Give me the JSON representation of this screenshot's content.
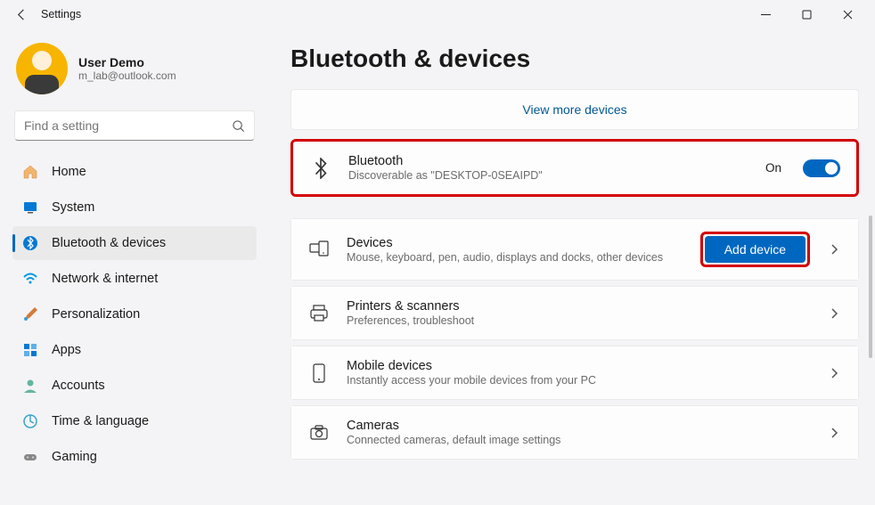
{
  "window": {
    "title": "Settings"
  },
  "user": {
    "name": "User Demo",
    "email": "m_lab@outlook.com"
  },
  "search": {
    "placeholder": "Find a setting"
  },
  "nav": [
    {
      "label": "Home"
    },
    {
      "label": "System"
    },
    {
      "label": "Bluetooth & devices"
    },
    {
      "label": "Network & internet"
    },
    {
      "label": "Personalization"
    },
    {
      "label": "Apps"
    },
    {
      "label": "Accounts"
    },
    {
      "label": "Time & language"
    },
    {
      "label": "Gaming"
    }
  ],
  "page": {
    "title": "Bluetooth & devices",
    "view_more": "View more devices",
    "bluetooth": {
      "title": "Bluetooth",
      "subtitle": "Discoverable as \"DESKTOP-0SEAIPD\"",
      "state": "On"
    },
    "rows": [
      {
        "title": "Devices",
        "subtitle": "Mouse, keyboard, pen, audio, displays and docks, other devices",
        "button": "Add device"
      },
      {
        "title": "Printers & scanners",
        "subtitle": "Preferences, troubleshoot"
      },
      {
        "title": "Mobile devices",
        "subtitle": "Instantly access your mobile devices from your PC"
      },
      {
        "title": "Cameras",
        "subtitle": "Connected cameras, default image settings"
      }
    ]
  }
}
